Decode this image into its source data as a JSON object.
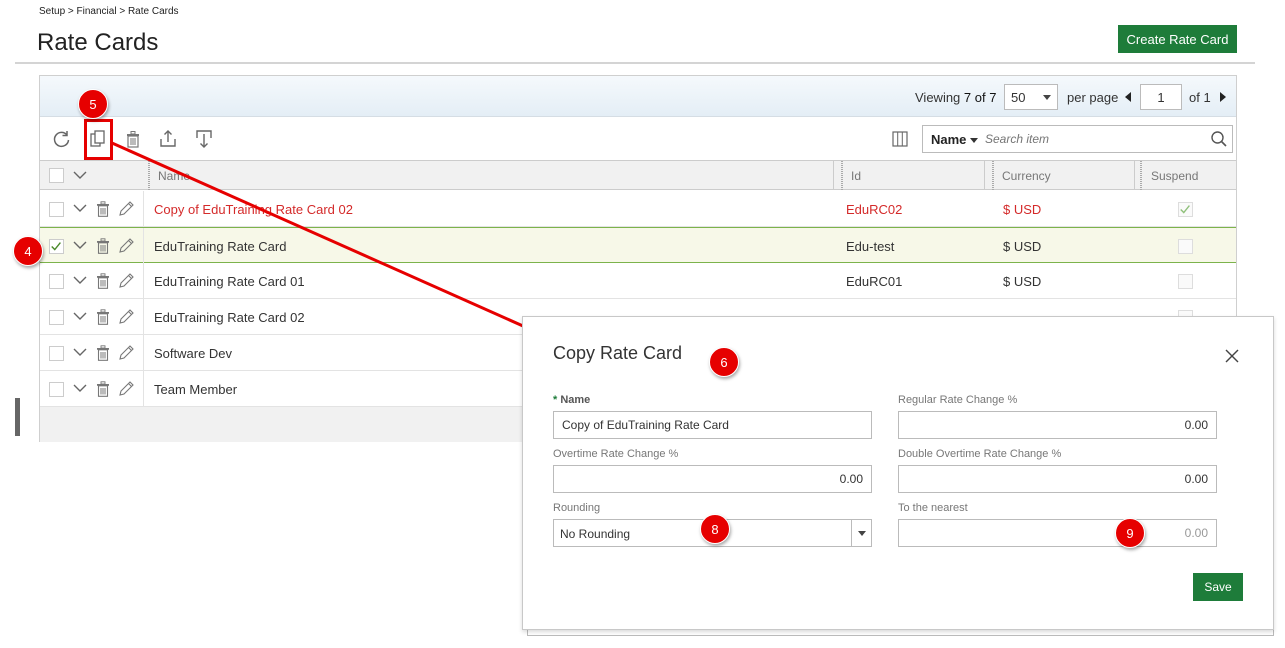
{
  "breadcrumb": "Setup > Financial > Rate Cards",
  "page_title": "Rate Cards",
  "create_button": "Create Rate Card",
  "pager": {
    "viewing_label": "Viewing",
    "viewing_count": "7 of 7",
    "per_page_value": "50",
    "per_page_label": "per page",
    "page_value": "1",
    "of_label": "of 1"
  },
  "toolbar": {
    "icons": [
      "refresh-icon",
      "copy-icon",
      "delete-icon",
      "export-icon",
      "import-icon",
      "columns-icon"
    ]
  },
  "search": {
    "field": "Name",
    "placeholder": "Search item"
  },
  "grid": {
    "columns": [
      "Name",
      "Id",
      "Currency",
      "Suspend"
    ],
    "rows": [
      {
        "name": "Copy of EduTraining Rate Card 02",
        "id": "EduRC02",
        "currency": "$ USD",
        "checked": false,
        "suspended": true,
        "style": "red"
      },
      {
        "name": "EduTraining Rate Card",
        "id": "Edu-test",
        "currency": "$ USD",
        "checked": true,
        "suspended": false,
        "style": "selected"
      },
      {
        "name": "EduTraining Rate Card 01",
        "id": "EduRC01",
        "currency": "$ USD",
        "checked": false,
        "suspended": false,
        "style": ""
      },
      {
        "name": "EduTraining Rate Card 02",
        "id": "",
        "currency": "",
        "checked": false,
        "suspended": false,
        "style": ""
      },
      {
        "name": "Software Dev",
        "id": "",
        "currency": "",
        "checked": false,
        "suspended": false,
        "style": ""
      },
      {
        "name": "Team Member",
        "id": "",
        "currency": "",
        "checked": false,
        "suspended": false,
        "style": ""
      }
    ]
  },
  "modal": {
    "title": "Copy Rate Card",
    "name_label": "Name",
    "name_required_mark": "*",
    "name_value": "Copy of EduTraining Rate Card",
    "regular_label": "Regular Rate Change %",
    "regular_value": "0.00",
    "overtime_label": "Overtime Rate Change %",
    "overtime_value": "0.00",
    "double_overtime_label": "Double Overtime Rate Change %",
    "double_overtime_value": "0.00",
    "rounding_label": "Rounding",
    "rounding_value": "No Rounding",
    "nearest_label": "To the nearest",
    "nearest_placeholder": "0.00",
    "save_label": "Save"
  },
  "markers": [
    "4",
    "5",
    "6",
    "8",
    "9"
  ],
  "colors": {
    "primary_green": "#1e7c3a",
    "marker_red": "#e60000",
    "new_row_red": "#d42a2a"
  }
}
